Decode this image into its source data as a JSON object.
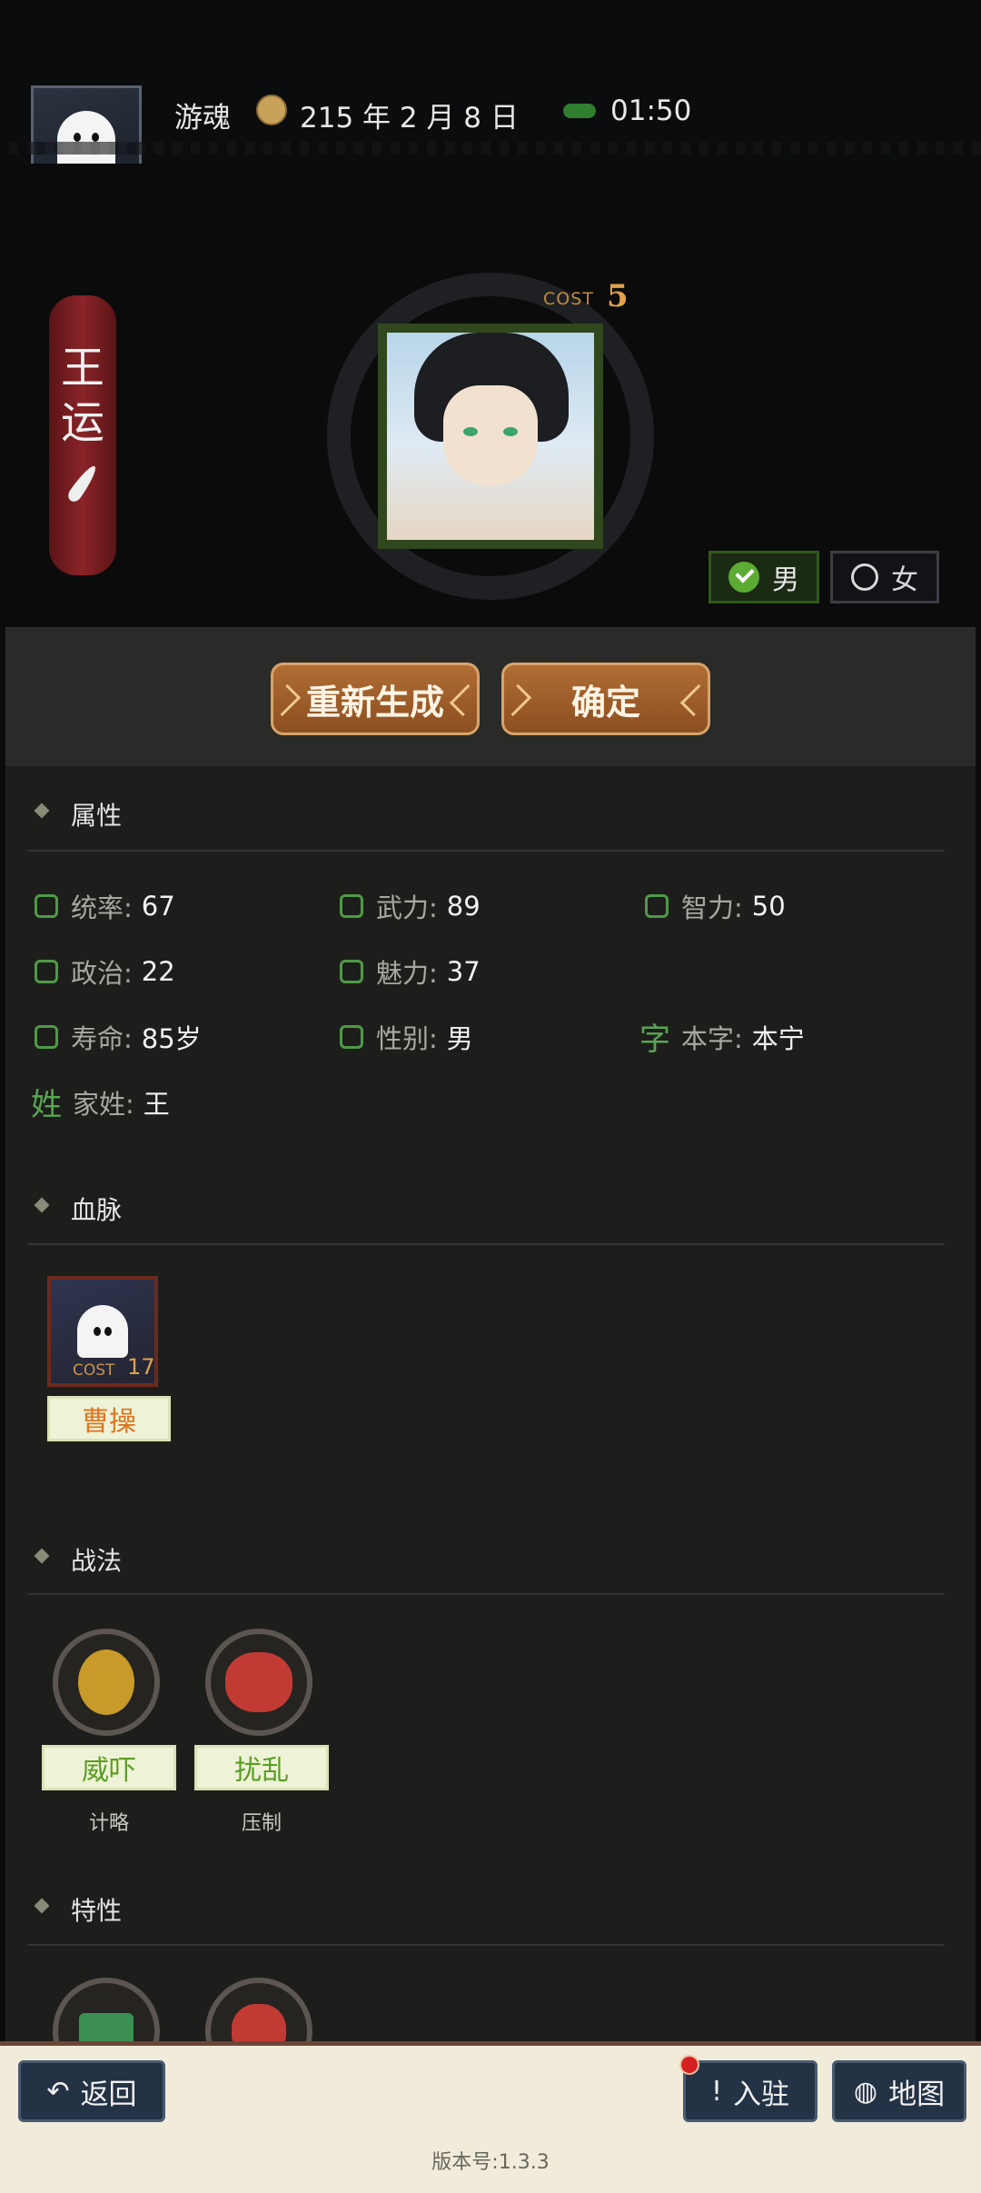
{
  "topbar": {
    "title": "游魂",
    "date": "215 年 2 月 8 日",
    "time": "01:50"
  },
  "hero": {
    "name_chars": [
      "王",
      "运"
    ],
    "cost_label": "COST",
    "cost_value": "5",
    "gender_male": "男",
    "gender_female": "女",
    "selected_gender": "男"
  },
  "actions": {
    "regenerate": "重新生成",
    "confirm": "确定"
  },
  "sections": {
    "attributes": "属性",
    "bloodline": "血脉",
    "tactics": "战法",
    "traits": "特性"
  },
  "attributes": {
    "command": {
      "label": "统率:",
      "value": "67"
    },
    "force": {
      "label": "武力:",
      "value": "89"
    },
    "intellect": {
      "label": "智力:",
      "value": "50"
    },
    "politics": {
      "label": "政治:",
      "value": "22"
    },
    "charm": {
      "label": "魅力:",
      "value": "37"
    },
    "lifespan": {
      "label": "寿命:",
      "value": "85岁"
    },
    "gender": {
      "label": "性别:",
      "value": "男"
    },
    "courtesy": {
      "icon_char": "字",
      "label": "本字:",
      "value": "本宁"
    },
    "surname": {
      "icon_char": "姓",
      "label": "家姓:",
      "value": "王"
    }
  },
  "bloodline": {
    "cost_label": "COST",
    "cost_value": "17",
    "name": "曹操"
  },
  "tactics": [
    {
      "name": "威吓",
      "type": "计略"
    },
    {
      "name": "扰乱",
      "type": "压制"
    }
  ],
  "bottom": {
    "back": "返回",
    "settle": "入驻",
    "settle_icon": "!",
    "map": "地图",
    "version": "版本号:1.3.3"
  }
}
